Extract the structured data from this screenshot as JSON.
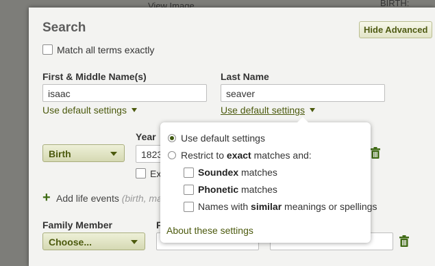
{
  "background": {
    "view_image_link": "View Image",
    "birth_text": "BIRTH: Dickens"
  },
  "dialog": {
    "title": "Search",
    "hide_advanced_label": "Hide Advanced",
    "match_all_label": "Match all terms exactly",
    "first_name": {
      "label": "First & Middle Name(s)",
      "value": "isaac",
      "settings_link": "Use default settings"
    },
    "last_name": {
      "label": "Last Name",
      "value": "seaver",
      "settings_link": "Use default settings"
    },
    "life_event": {
      "event_type": "Birth",
      "year_label": "Year",
      "year_value": "1823",
      "exact_label": "Ex"
    },
    "add_life_events": {
      "label": "Add life events",
      "hint": "(birth, marr"
    },
    "family": {
      "member_label": "Family Member",
      "member_select": "Choose...",
      "first_name_label": "F"
    }
  },
  "popup": {
    "option_default": "Use default settings",
    "option_restrict_pre": "Restrict to ",
    "option_restrict_bold": "exact",
    "option_restrict_post": " matches and:",
    "soundex_bold": "Soundex",
    "soundex_rest": " matches",
    "phonetic_bold": "Phonetic",
    "phonetic_rest": " matches",
    "similar_pre": "Names with ",
    "similar_bold": "similar",
    "similar_post": " meanings or spellings",
    "about_link": "About these settings",
    "selected_option": "default"
  },
  "colors": {
    "accent": "#4c5a0e",
    "panel_bg": "#f3f3f1",
    "trash": "#3f6a14"
  }
}
